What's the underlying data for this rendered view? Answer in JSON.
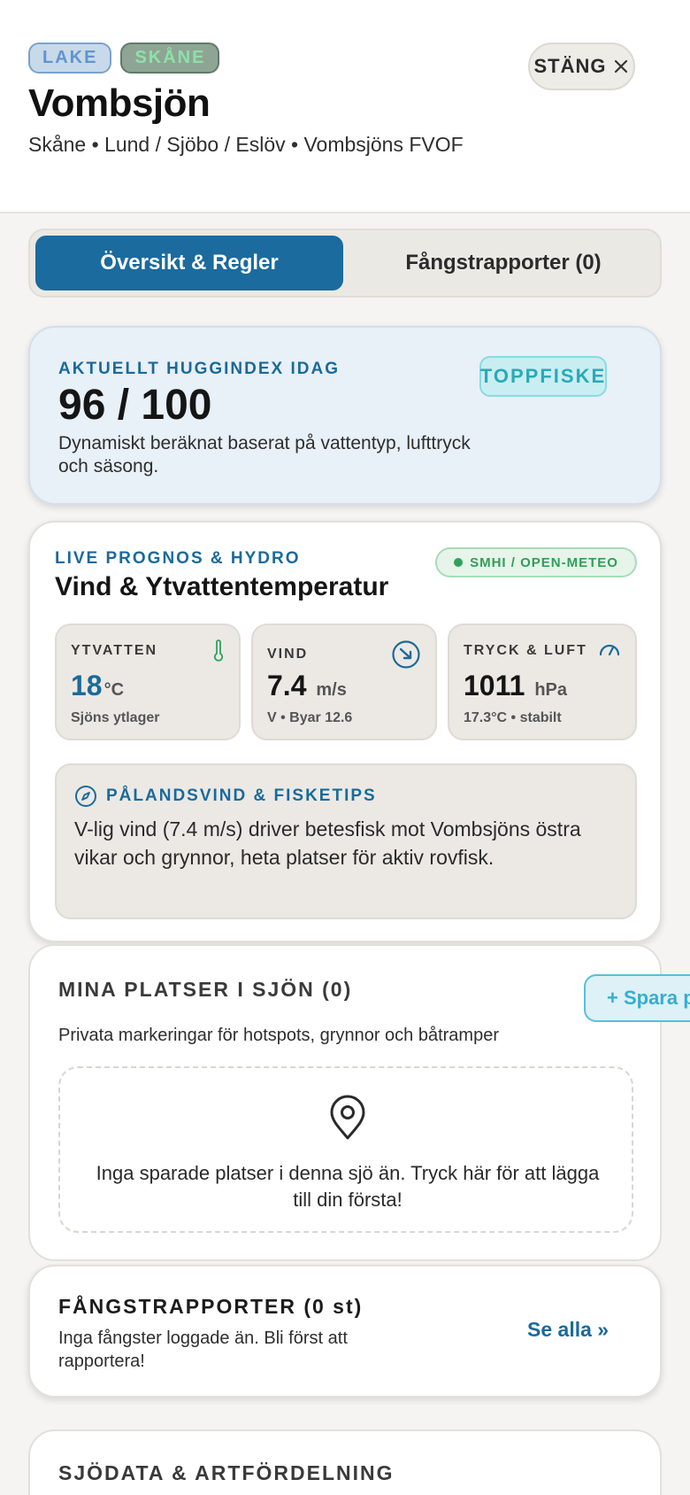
{
  "header": {
    "badges": [
      "LAKE",
      "SKÅNE"
    ],
    "title": "Vombsjön",
    "subtitle": "Skåne • Lund / Sjöbo / Eslöv • Vombsjöns FVOF",
    "close_label": "STÄNG"
  },
  "tabs": [
    {
      "label": "Översikt & Regler",
      "active": true
    },
    {
      "label": "Fångstrapporter (0)",
      "active": false
    }
  ],
  "index": {
    "label": "AKTUELLT HUGGINDEX IDAG",
    "value": "96 / 100",
    "description": "Dynamiskt beräknat baserat på vattentyp, lufttryck och säsong.",
    "status": "TOPPFISKE"
  },
  "weather": {
    "label": "LIVE PROGNOS & HYDRO",
    "title": "Vind & Ytvattentemperatur",
    "source": "SMHI / OPEN-METEO",
    "stats": [
      {
        "label": "YTVATTEN",
        "value": "18",
        "unit": "°C",
        "sub": "Sjöns ytlager",
        "icon": "thermometer-icon"
      },
      {
        "label": "VIND",
        "value": "7.4",
        "unit": "m/s",
        "sub": "V • Byar 12.6",
        "icon": "wind-direction-icon"
      },
      {
        "label": "TRYCK & LUFT",
        "value": "1011",
        "unit": "hPa",
        "sub": "17.3°C • stabilt",
        "icon": "gauge-icon"
      }
    ],
    "tip": {
      "title": "PÅLANDSVIND & FISKETIPS",
      "text": "V-lig vind (7.4 m/s) driver betesfisk mot Vombsjöns östra vikar och grynnor, heta platser för aktiv rovfisk."
    }
  },
  "places": {
    "title": "MINA PLATSER I SJÖN (0)",
    "save_label": "+ Spara plats",
    "description": "Privata markeringar för hotspots, grynnor och båtramper",
    "empty_text": "Inga sparade platser i denna sjö än. Tryck här för att lägga till din första!"
  },
  "catch": {
    "title": "FÅNGSTRAPPORTER (0 st)",
    "description": "Inga fångster loggade än. Bli först att rapportera!",
    "see_all": "Se alla »"
  },
  "lake_data": {
    "title": "SJÖDATA & ARTFÖRDELNING"
  },
  "colors": {
    "accent": "#1b6b9e",
    "success": "#2fa35a",
    "cyan": "#2aa9b8"
  }
}
